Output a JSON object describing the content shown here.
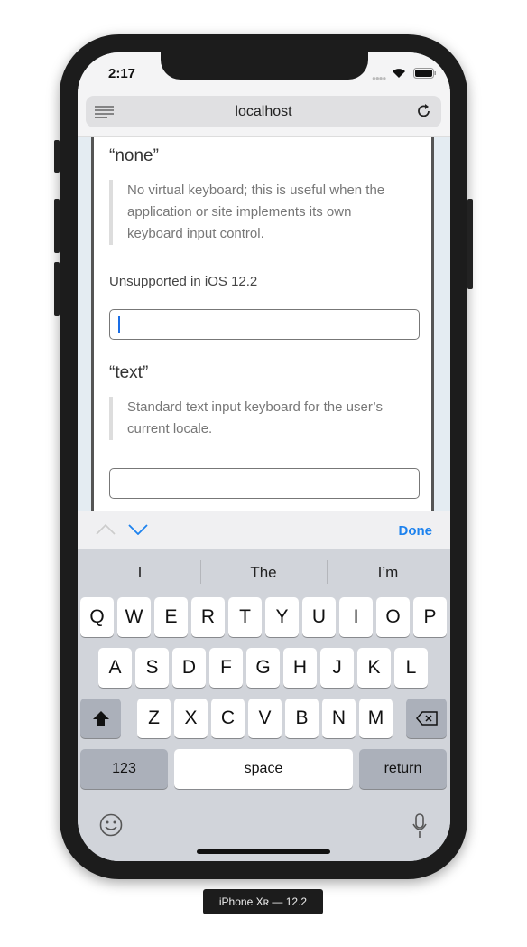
{
  "status": {
    "time": "2:17"
  },
  "browser": {
    "address": "localhost"
  },
  "content": {
    "section1_title": "“none”",
    "section1_desc": "No virtual keyboard; this is useful when the application or site implements its own keyboard input control.",
    "section1_note": "Unsupported in iOS 12.2",
    "section2_title": "“text”",
    "section2_desc": "Standard text input keyboard for the user’s current locale."
  },
  "accessory": {
    "done": "Done"
  },
  "keyboard": {
    "suggestions": [
      "I",
      "The",
      "I’m"
    ],
    "row1": [
      "Q",
      "W",
      "E",
      "R",
      "T",
      "Y",
      "U",
      "I",
      "O",
      "P"
    ],
    "row2": [
      "A",
      "S",
      "D",
      "F",
      "G",
      "H",
      "J",
      "K",
      "L"
    ],
    "row3": [
      "Z",
      "X",
      "C",
      "V",
      "B",
      "N",
      "M"
    ],
    "numbers": "123",
    "space": "space",
    "return": "return"
  },
  "device_label": "iPhone Xʀ — 12.2",
  "colors": {
    "accent": "#1d82ee",
    "caret": "#1a6ee6"
  }
}
